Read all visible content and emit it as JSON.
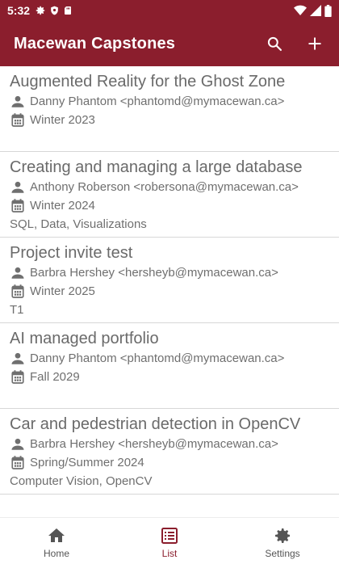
{
  "status_bar": {
    "time": "5:32",
    "left_icons": [
      "gear-icon",
      "shield-icon",
      "sd-card-icon"
    ],
    "right_icons": [
      "wifi-icon",
      "signal-icon",
      "battery-icon"
    ]
  },
  "app_bar": {
    "title": "Macewan Capstones",
    "actions": [
      "search-icon",
      "add-icon"
    ]
  },
  "colors": {
    "primary": "#8b1e2d",
    "text_muted": "#6f6f6f"
  },
  "projects": [
    {
      "title": "Augmented Reality for the Ghost Zone",
      "owner": "Danny Phantom <phantomd@mymacewan.ca>",
      "term": "Winter 2023",
      "tags": ""
    },
    {
      "title": "Creating and managing a large database",
      "owner": "Anthony Roberson <robersona@mymacewan.ca>",
      "term": "Winter 2024",
      "tags": "SQL, Data, Visualizations"
    },
    {
      "title": "Project invite test",
      "owner": "Barbra Hershey <hersheyb@mymacewan.ca>",
      "term": "Winter 2025",
      "tags": "T1"
    },
    {
      "title": "AI managed portfolio",
      "owner": "Danny Phantom <phantomd@mymacewan.ca>",
      "term": "Fall 2029",
      "tags": ""
    },
    {
      "title": "Car and pedestrian detection in OpenCV",
      "owner": "Barbra Hershey <hersheyb@mymacewan.ca>",
      "term": "Spring/Summer 2024",
      "tags": "Computer Vision, OpenCV"
    }
  ],
  "bottom_nav": {
    "items": [
      {
        "label": "Home",
        "icon": "home-icon",
        "active": false
      },
      {
        "label": "List",
        "icon": "list-icon",
        "active": true
      },
      {
        "label": "Settings",
        "icon": "settings-icon",
        "active": false
      }
    ]
  }
}
